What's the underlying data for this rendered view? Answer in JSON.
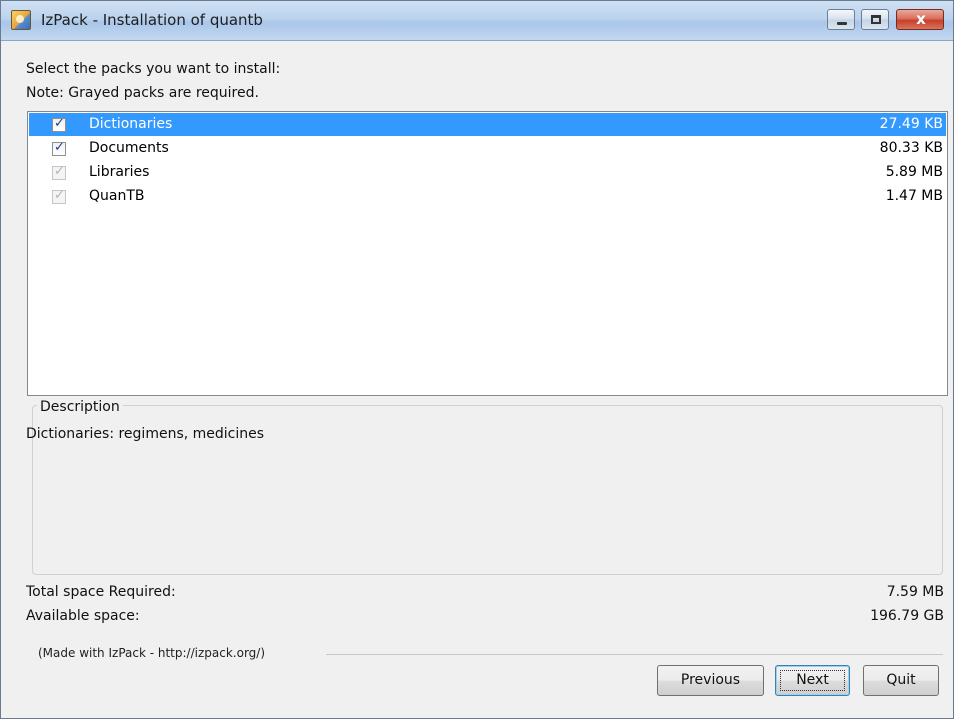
{
  "window": {
    "title": "IzPack - Installation of quantb",
    "controls": {
      "minimize_icon": "minimize-icon",
      "maximize_icon": "maximize-icon",
      "close_icon": "close-icon",
      "close_glyph": "x"
    }
  },
  "labels": {
    "select_prompt": "Select the packs you want to install:",
    "note": "Note: Grayed packs are required."
  },
  "packs": [
    {
      "name": "Dictionaries",
      "size": "27.49 KB",
      "checked": true,
      "required": false,
      "selected": true
    },
    {
      "name": "Documents",
      "size": "80.33 KB",
      "checked": true,
      "required": false,
      "selected": false
    },
    {
      "name": "Libraries",
      "size": "5.89 MB",
      "checked": true,
      "required": true,
      "selected": false
    },
    {
      "name": "QuanTB",
      "size": "1.47 MB",
      "checked": true,
      "required": true,
      "selected": false
    }
  ],
  "description": {
    "legend": "Description",
    "text": "Dictionaries: regimens, medicines"
  },
  "space": {
    "required_label": "Total space Required:",
    "required_value": "7.59 MB",
    "available_label": "Available space:",
    "available_value": "196.79 GB"
  },
  "footer": {
    "credit": "(Made with IzPack - http://izpack.org/)"
  },
  "buttons": {
    "previous": "Previous",
    "next": "Next",
    "quit": "Quit"
  },
  "colors": {
    "selection": "#3399ff",
    "window_bg": "#f0f0f0"
  }
}
